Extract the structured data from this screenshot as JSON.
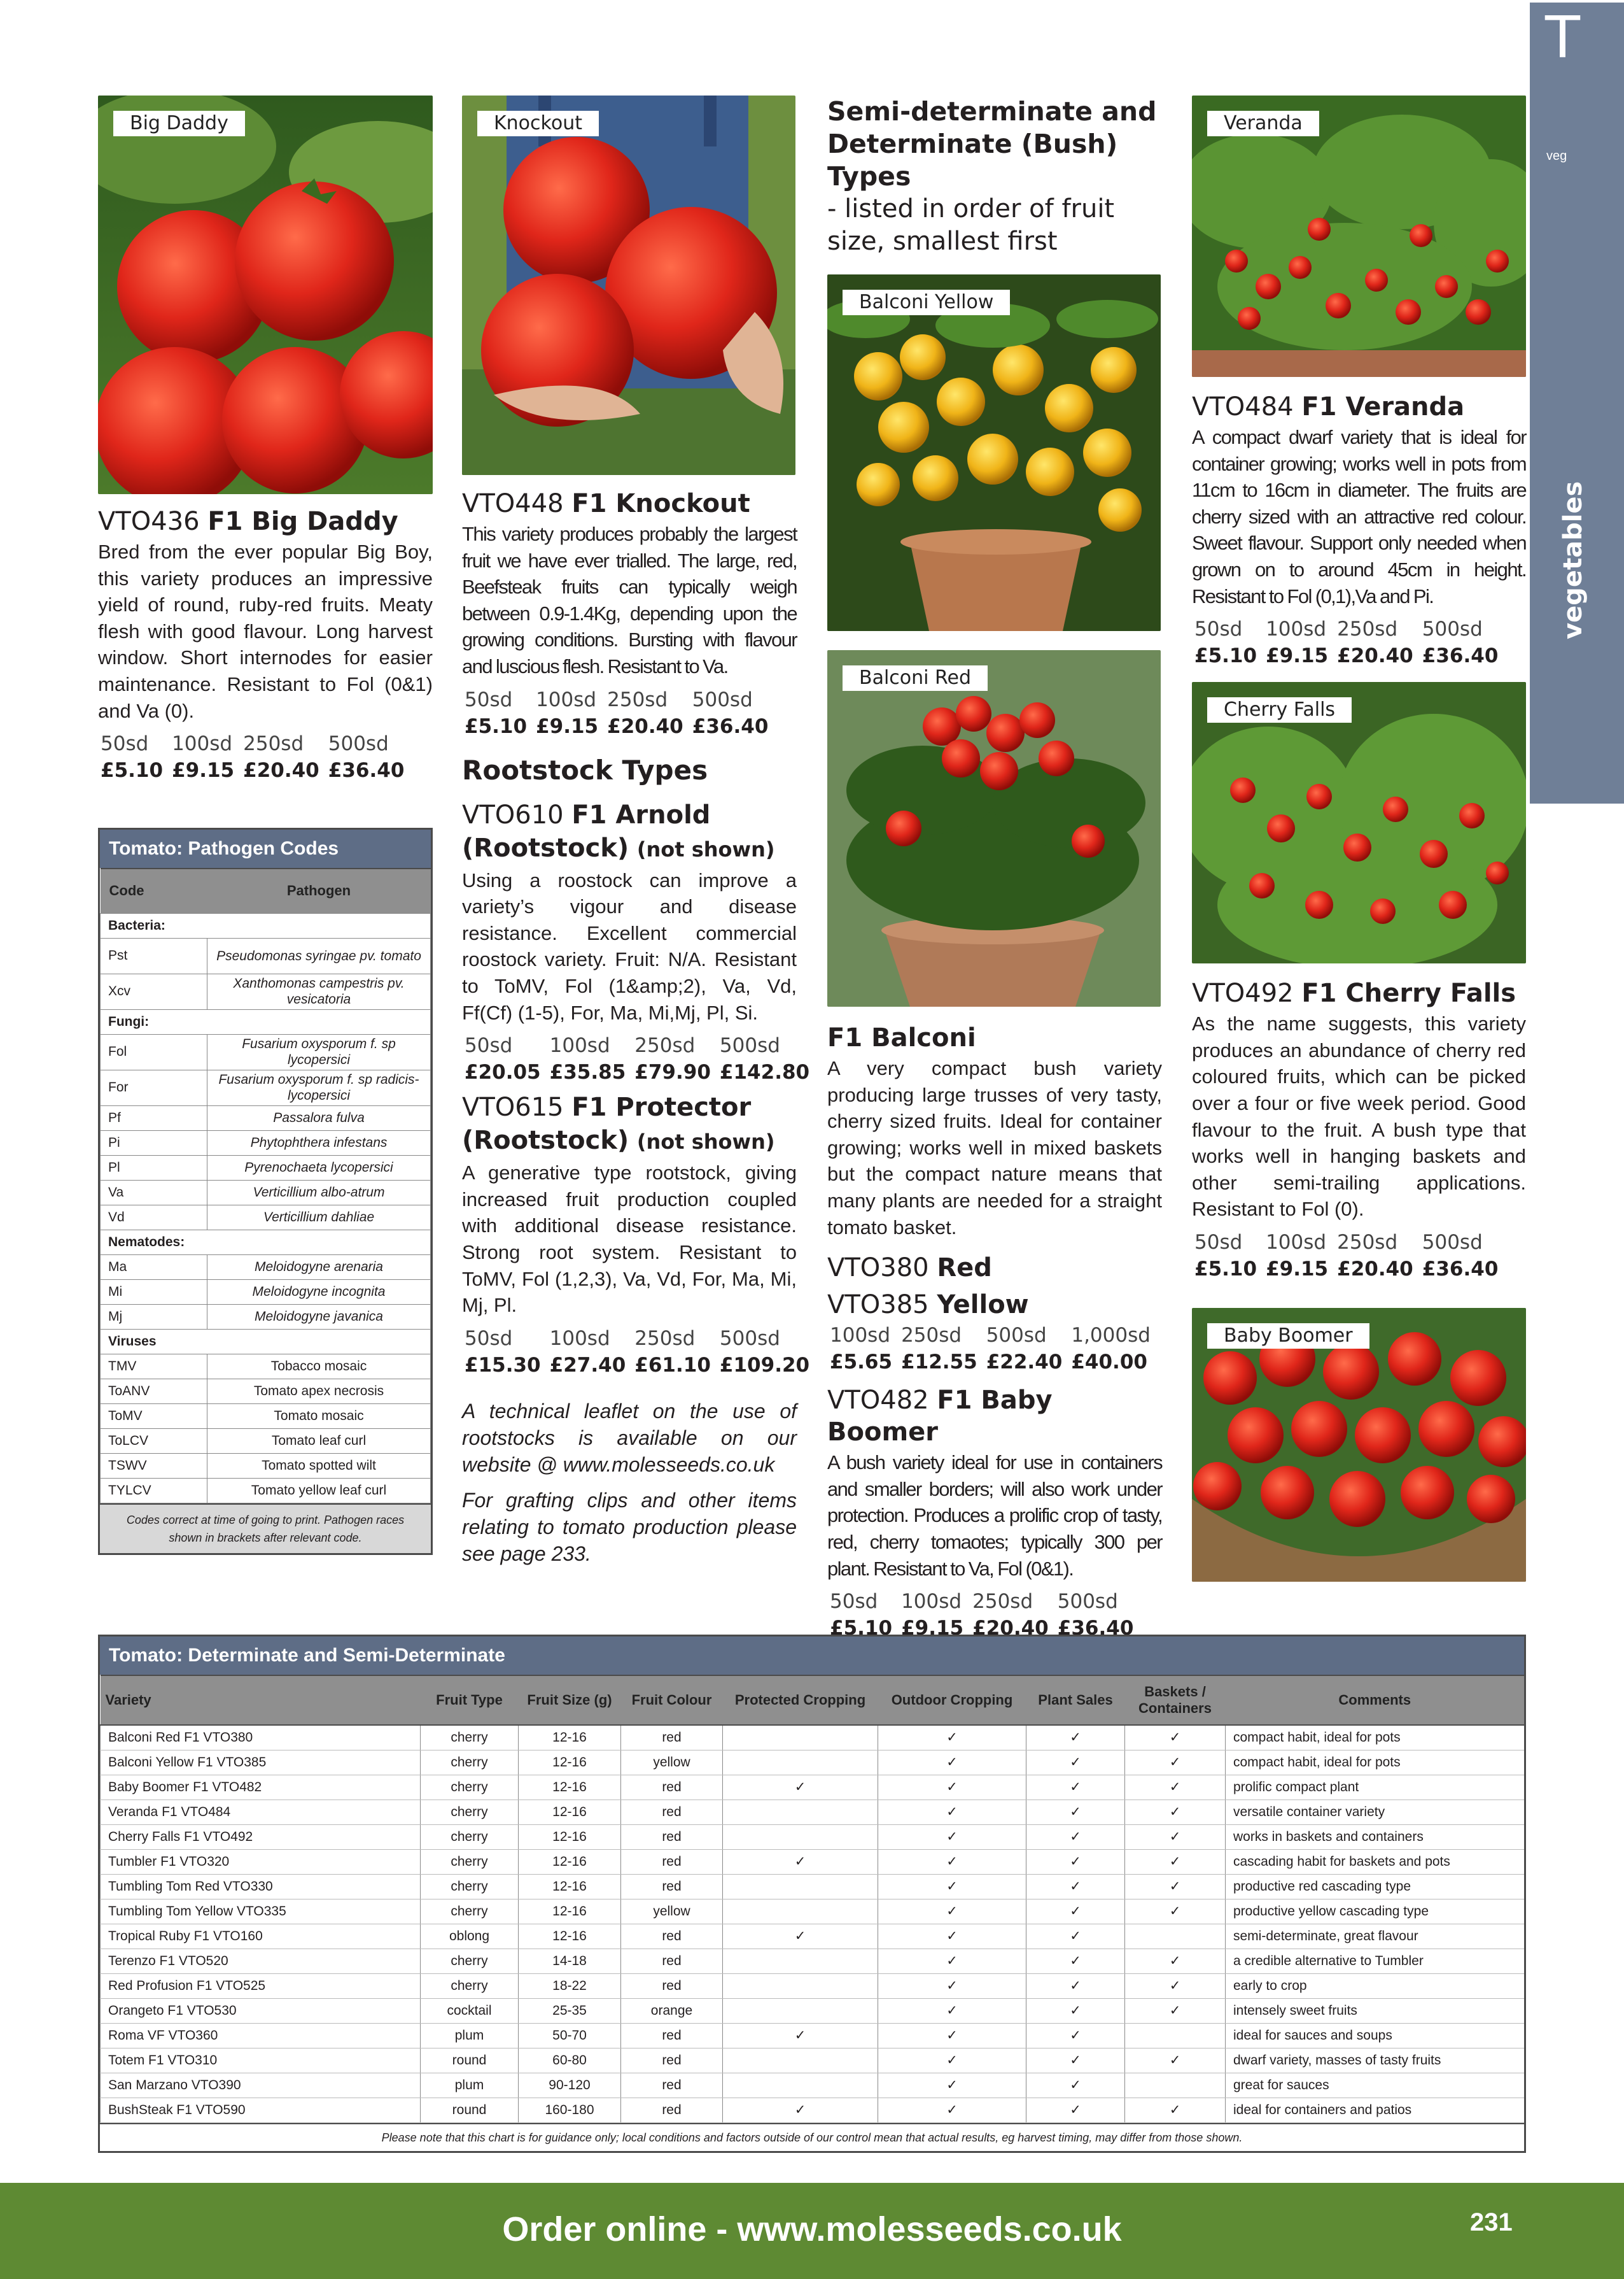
{
  "side_tab": {
    "letter": "T",
    "small": "veg",
    "vertical": "vegetables"
  },
  "footer": {
    "url_text": "Order online - www.molesseeds.co.uk",
    "page_number": "231"
  },
  "colors": {
    "accent": "#5e6d86",
    "footer_green": "#5e8a33",
    "sidetab": "#6f7f97"
  },
  "col1": {
    "photo_tag": "Big Daddy",
    "code": "VTO436 ",
    "name": "F1 Big Daddy",
    "desc": "Bred from the ever popular Big Boy, this variety produces an impressive yield of round, ruby-red fruits. Meaty flesh with good flavour. Long harvest window. Short internodes for easier maintenance. Resistant to Fol (0&1) and Va (0).",
    "sizes": [
      "50sd",
      "100sd",
      "250sd",
      "500sd"
    ],
    "prices": [
      "£5.10",
      "£9.15",
      "£20.40",
      "£36.40"
    ]
  },
  "col2": {
    "photo_tag": "Knockout",
    "code": "VTO448 ",
    "name": "F1 Knockout",
    "desc": "This variety produces probably the largest fruit we have ever trialled. The large, red, Beefsteak fruits can typically weigh between 0.9-1.4Kg, depending upon the growing conditions. Bursting with flavour and luscious flesh. Resistant to Va.",
    "sizes": [
      "50sd",
      "100sd",
      "250sd",
      "500sd"
    ],
    "prices": [
      "£5.10",
      "£9.15",
      "£20.40",
      "£36.40"
    ],
    "rootstock_heading": "Rootstock Types",
    "arnold": {
      "code": "VTO610 ",
      "name": "F1 Arnold",
      "name2": "(Rootstock)",
      "not_shown": "(not shown)",
      "desc": "Using a roostock can improve a variety’s vigour and disease resistance. Excellent commercial roostock variety. Fruit: N/A. Resistant to ToMV, Fol (1&amp;2), Va, Vd, Ff(Cf) (1-5), For, Ma, Mi,Mj, Pl, Si.",
      "sizes": [
        "50sd",
        "100sd",
        "250sd",
        "500sd"
      ],
      "prices": [
        "£20.05",
        "£35.85",
        "£79.90",
        "£142.80"
      ]
    },
    "protector": {
      "code": "VTO615 ",
      "name": "F1 Protector",
      "name2": "(Rootstock)",
      "not_shown": "(not shown)",
      "desc": "A generative type rootstock, giving increased fruit production coupled with additional disease resistance. Strong root system. Resistant to ToMV, Fol (1,2,3), Va, Vd, For, Ma, Mi, Mj, Pl.",
      "sizes": [
        "50sd",
        "100sd",
        "250sd",
        "500sd"
      ],
      "prices": [
        "£15.30",
        "£27.40",
        "£61.10",
        "£109.20"
      ]
    },
    "note1": "A technical leaflet on the use of rootstocks is available on our website @ www.molesseeds.co.uk",
    "note2": "For grafting clips and other items relating to tomato production please see page 233."
  },
  "col3": {
    "heading": "Semi-determinate and Determinate (Bush) Types",
    "subheading": "- listed in order of fruit size, smallest first",
    "photo1_tag": "Balconi Yellow",
    "photo2_tag": "Balconi Red",
    "balconi_title": "F1 Balconi",
    "balconi_desc": "A very compact bush variety producing large trusses of very tasty, cherry sized fruits. Ideal for container growing; works well in mixed baskets but the compact nature means that many plants are needed for a straight tomato basket.",
    "red_code": "VTO380 ",
    "red_name": "Red",
    "yellow_code": "VTO385 ",
    "yellow_name": "Yellow",
    "balconi_sizes": [
      "100sd",
      "250sd",
      "500sd",
      "1,000sd"
    ],
    "balconi_prices": [
      "£5.65",
      "£12.55",
      "£22.40",
      "£40.00"
    ],
    "boomer_code": "VTO482 ",
    "boomer_name": "F1 Baby Boomer",
    "boomer_desc": "A bush variety ideal for use in containers and smaller borders; will also work under protection. Produces a prolific crop of tasty, red, cherry tomaotes; typically 300 per plant. Resistant to Va, Fol (0&1).",
    "boomer_sizes": [
      "50sd",
      "100sd",
      "250sd",
      "500sd"
    ],
    "boomer_prices": [
      "£5.10",
      "£9.15",
      "£20.40",
      "£36.40"
    ]
  },
  "col4": {
    "photo1_tag": "Veranda",
    "veranda_code": "VTO484 ",
    "veranda_name": "F1 Veranda",
    "veranda_desc": "A compact dwarf variety that is ideal for container growing; works well in pots from 11cm to 16cm in diameter. The fruits are cherry sized with an attractive red colour. Sweet flavour. Support only needed when grown on to around 45cm in height. Resistant to Fol (0,1),Va and Pi.",
    "veranda_sizes": [
      "50sd",
      "100sd",
      "250sd",
      "500sd"
    ],
    "veranda_prices": [
      "£5.10",
      "£9.15",
      "£20.40",
      "£36.40"
    ],
    "photo2_tag": "Cherry Falls",
    "falls_code": "VTO492 ",
    "falls_name": "F1 Cherry Falls",
    "falls_desc": "As the name suggests, this variety produces an abundance of cherry red coloured fruits, which can be picked over a four or five week period. Good flavour to the fruit. A bush type that works well in hanging baskets and other semi-trailing applications. Resistant to Fol (0).",
    "falls_sizes": [
      "50sd",
      "100sd",
      "250sd",
      "500sd"
    ],
    "falls_prices": [
      "£5.10",
      "£9.15",
      "£20.40",
      "£36.40"
    ],
    "photo3_tag": "Baby Boomer"
  },
  "pathogen": {
    "title": "Tomato: Pathogen Codes",
    "col_code": "Code",
    "col_pathogen": "Pathogen",
    "rows": [
      {
        "section": "Bacteria:"
      },
      {
        "code": "Pst",
        "name": "Pseudomonas syringae pv. tomato",
        "italic": true
      },
      {
        "code": "Xcv",
        "name": "Xanthomonas campestris pv. vesicatoria",
        "italic": true
      },
      {
        "section": "Fungi:"
      },
      {
        "code": "Fol",
        "name": "Fusarium oxysporum f. sp lycopersici",
        "italic": true
      },
      {
        "code": "For",
        "name": "Fusarium oxysporum f. sp radicis-lycopersici",
        "italic": true
      },
      {
        "code": "Pf",
        "name": "Passalora fulva",
        "italic": true
      },
      {
        "code": "Pi",
        "name": "Phytophthera infestans",
        "italic": true
      },
      {
        "code": "Pl",
        "name": "Pyrenochaeta lycopersici",
        "italic": true
      },
      {
        "code": "Va",
        "name": "Verticillium albo-atrum",
        "italic": true
      },
      {
        "code": "Vd",
        "name": "Verticillium dahliae",
        "italic": true
      },
      {
        "section": "Nematodes:"
      },
      {
        "code": "Ma",
        "name": "Meloidogyne arenaria",
        "italic": true
      },
      {
        "code": "Mi",
        "name": "Meloidogyne incognita",
        "italic": true
      },
      {
        "code": "Mj",
        "name": "Meloidogyne javanica",
        "italic": true
      },
      {
        "section": "Viruses"
      },
      {
        "code": "TMV",
        "name": "Tobacco mosaic",
        "italic": false
      },
      {
        "code": "ToANV",
        "name": "Tomato apex necrosis",
        "italic": false
      },
      {
        "code": "ToMV",
        "name": "Tomato mosaic",
        "italic": false
      },
      {
        "code": "ToLCV",
        "name": "Tomato leaf curl",
        "italic": false
      },
      {
        "code": "TSWV",
        "name": "Tomato spotted wilt",
        "italic": false
      },
      {
        "code": "TYLCV",
        "name": "Tomato yellow leaf curl",
        "italic": false
      }
    ],
    "footnote": "Codes correct at time of going to print. Pathogen races shown in brackets after relevant code."
  },
  "determinate": {
    "title": "Tomato: Determinate and Semi-Determinate",
    "headers": [
      "Variety",
      "Fruit Type",
      "Fruit Size (g)",
      "Fruit Colour",
      "Protected Cropping",
      "Outdoor Cropping",
      "Plant Sales",
      "Baskets / Containers",
      "Comments"
    ],
    "check": "✓",
    "rows": [
      [
        "Balconi Red F1 VTO380",
        "cherry",
        "12-16",
        "red",
        0,
        1,
        1,
        1,
        "compact habit, ideal for pots"
      ],
      [
        "Balconi Yellow F1 VTO385",
        "cherry",
        "12-16",
        "yellow",
        0,
        1,
        1,
        1,
        "compact habit, ideal for pots"
      ],
      [
        "Baby Boomer F1 VTO482",
        "cherry",
        "12-16",
        "red",
        1,
        1,
        1,
        1,
        "prolific compact plant"
      ],
      [
        "Veranda F1 VTO484",
        "cherry",
        "12-16",
        "red",
        0,
        1,
        1,
        1,
        "versatile container variety"
      ],
      [
        "Cherry Falls F1 VTO492",
        "cherry",
        "12-16",
        "red",
        0,
        1,
        1,
        1,
        "works in baskets and containers"
      ],
      [
        "Tumbler F1 VTO320",
        "cherry",
        "12-16",
        "red",
        1,
        1,
        1,
        1,
        "cascading habit for baskets and pots"
      ],
      [
        "Tumbling Tom Red VTO330",
        "cherry",
        "12-16",
        "red",
        0,
        1,
        1,
        1,
        "productive red cascading type"
      ],
      [
        "Tumbling Tom Yellow VTO335",
        "cherry",
        "12-16",
        "yellow",
        0,
        1,
        1,
        1,
        "productive yellow cascading type"
      ],
      [
        "Tropical Ruby F1 VTO160",
        "oblong",
        "12-16",
        "red",
        1,
        1,
        1,
        0,
        "semi-determinate, great flavour"
      ],
      [
        "Terenzo F1 VTO520",
        "cherry",
        "14-18",
        "red",
        0,
        1,
        1,
        1,
        "a credible alternative to Tumbler"
      ],
      [
        "Red Profusion F1 VTO525",
        "cherry",
        "18-22",
        "red",
        0,
        1,
        1,
        1,
        "early to crop"
      ],
      [
        "Orangeto F1 VTO530",
        "cocktail",
        "25-35",
        "orange",
        0,
        1,
        1,
        1,
        "intensely sweet fruits"
      ],
      [
        "Roma VF VTO360",
        "plum",
        "50-70",
        "red",
        1,
        1,
        1,
        0,
        "ideal for sauces and soups"
      ],
      [
        "Totem F1 VTO310",
        "round",
        "60-80",
        "red",
        0,
        1,
        1,
        1,
        "dwarf variety, masses of tasty fruits"
      ],
      [
        "San Marzano VTO390",
        "plum",
        "90-120",
        "red",
        0,
        1,
        1,
        0,
        "great for sauces"
      ],
      [
        "BushSteak F1 VTO590",
        "round",
        "160-180",
        "red",
        1,
        1,
        1,
        1,
        "ideal for containers and patios"
      ]
    ],
    "footnote": "Please note that this chart is for guidance only; local conditions and factors outside of our control mean that actual results, eg harvest timing, may differ from those shown."
  }
}
